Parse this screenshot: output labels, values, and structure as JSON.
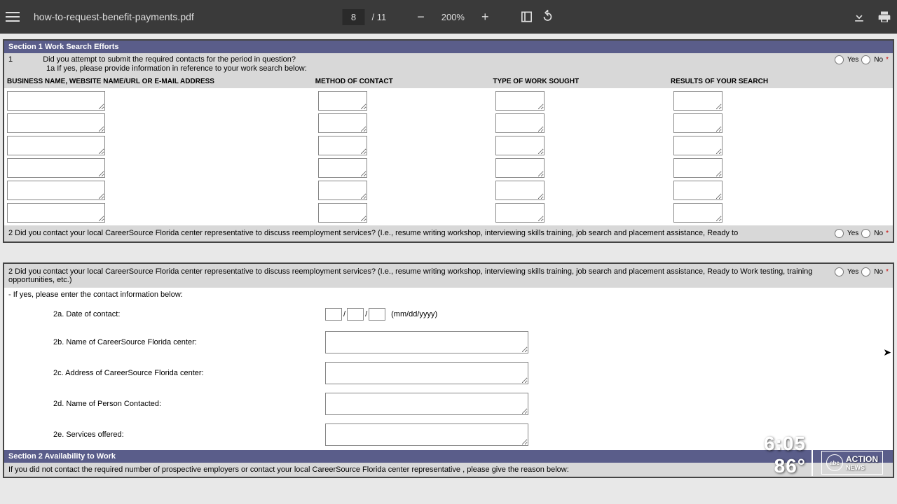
{
  "toolbar": {
    "filename": "how-to-request-benefit-payments.pdf",
    "current_page": "8",
    "total_pages": "/ 11",
    "zoom": "200%"
  },
  "section1": {
    "header": "Section 1 Work Search Efforts",
    "q1_num": "1",
    "q1_text": "Did you attempt to submit the required contacts for the period in question?",
    "q1a_text": "1a If yes, please provide information in reference to your work search below:",
    "yes": "Yes",
    "no": "No",
    "col1": "BUSINESS NAME, WEBSITE NAME/URL OR E-MAIL ADDRESS",
    "col2": "METHOD OF CONTACT",
    "col3": "TYPE OF WORK SOUGHT",
    "col4": "RESULTS OF YOUR SEARCH",
    "q2_text": "2 Did you contact your local CareerSource Florida center representative to discuss reemployment services? (I.e., resume writing workshop, interviewing skills training, job search and placement assistance, Ready to"
  },
  "section_repeat": {
    "q2_full": "2 Did you contact your local CareerSource Florida center representative to discuss reemployment services? (I.e., resume writing workshop, interviewing skills training, job search and placement assistance, Ready to Work testing, training opportunities, etc.)",
    "if_yes": "- If yes, please enter the contact information below:",
    "q2a": "2a. Date of contact:",
    "date_hint": "(mm/dd/yyyy)",
    "q2b": "2b. Name of CareerSource Florida center:",
    "q2c": "2c. Address of CareerSource Florida center:",
    "q2d": "2d. Name of Person Contacted:",
    "q2e": "2e. Services offered:",
    "yes": "Yes",
    "no": "No"
  },
  "section2": {
    "header": "Section 2 Availability to Work",
    "instruction": "If you did not contact the required number of prospective employers or contact your local CareerSource Florida center representative , please give the reason below:"
  },
  "overlay": {
    "time": "6:05",
    "temp": "86°",
    "logo_text": "ACTION",
    "logo_sub": "NEWS",
    "abc": "abc"
  }
}
